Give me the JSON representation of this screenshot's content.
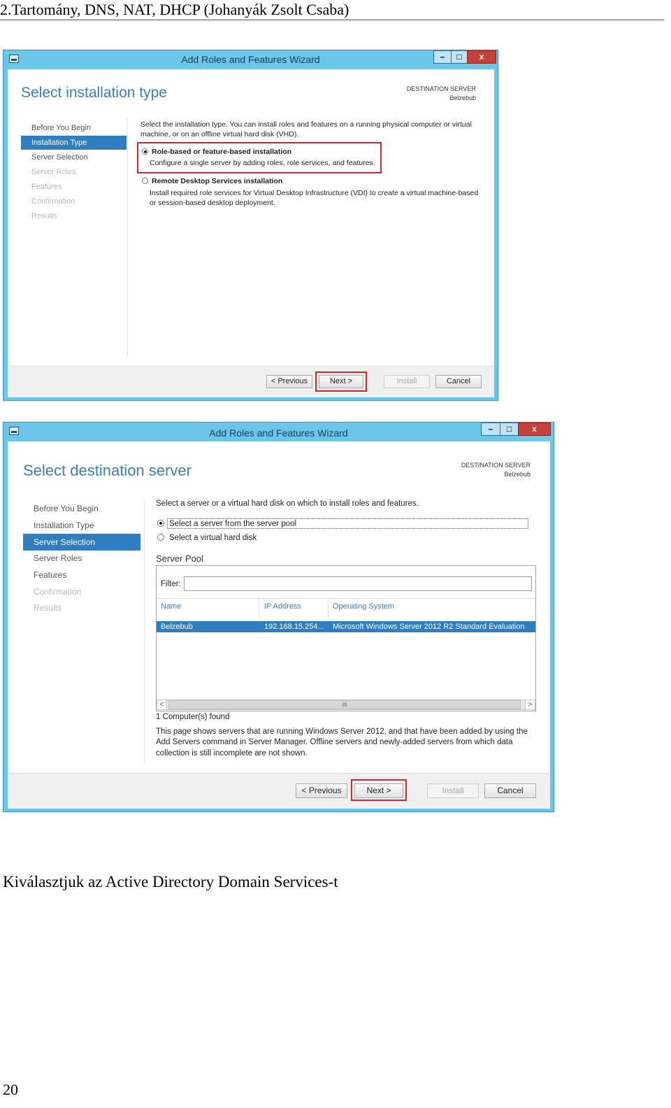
{
  "doc": {
    "header": "2.Tartomány, DNS, NAT, DHCP (Johanyák Zsolt Csaba)",
    "caption": "Kiválasztjuk az Active Directory Domain Services-t",
    "page_number": "20"
  },
  "colors": {
    "titlebar": "#6cc6ea",
    "accent": "#2f7ec1",
    "title_text": "#3b7fb6",
    "highlight": "#d8252d",
    "close": "#c7413a"
  },
  "window1": {
    "title": "Add Roles and Features Wizard",
    "page_title": "Select installation type",
    "dest_label": "DESTINATION SERVER",
    "dest_server": "Belzebub",
    "nav": [
      "Before You Begin",
      "Installation Type",
      "Server Selection",
      "Server Roles",
      "Features",
      "Confirmation",
      "Results"
    ],
    "intro_line1": "Select the installation type. You can install roles and features on a running physical computer or virtual",
    "intro_line2": "machine, or on an offline virtual hard disk (VHD).",
    "option1_title": "Role-based or feature-based installation",
    "option1_desc": "Configure a single server by adding roles, role services, and features.",
    "option2_title": "Remote Desktop Services installation",
    "option2_desc_line1": "Install required role services for Virtual Desktop Infrastructure (VDI) to create a virtual machine-based",
    "option2_desc_line2": "or session-based desktop deployment.",
    "buttons": {
      "previous": "< Previous",
      "next": "Next >",
      "install": "Install",
      "cancel": "Cancel"
    },
    "controls": {
      "minimize": "–",
      "maximize": "□",
      "close": "x"
    }
  },
  "window2": {
    "title": "Add Roles and Features Wizard",
    "page_title": "Select destination server",
    "dest_label": "DESTINATION SERVER",
    "dest_server": "Belzebub",
    "nav": [
      "Before You Begin",
      "Installation Type",
      "Server Selection",
      "Server Roles",
      "Features",
      "Confirmation",
      "Results"
    ],
    "intro": "Select a server or a virtual hard disk on which to install roles and features.",
    "option1": "Select a server from the server pool",
    "option2": "Select a virtual hard disk",
    "pool_title": "Server Pool",
    "filter_label": "Filter:",
    "filter_value": "",
    "columns": [
      "Name",
      "IP Address",
      "Operating System"
    ],
    "rows": [
      {
        "name": "Belzebub",
        "ip": "192.168.15.254...",
        "os": "Microsoft Windows Server 2012 R2 Standard Evaluation"
      }
    ],
    "scroll_left": "<",
    "scroll_right": ">",
    "scroll_grip": "III",
    "count": "1 Computer(s) found",
    "note_line1": "This page shows servers that are running Windows Server 2012, and that have been added by using the",
    "note_line2": "Add Servers command in Server Manager. Offline servers and newly-added servers from which data",
    "note_line3": "collection is still incomplete are not shown.",
    "buttons": {
      "previous": "< Previous",
      "next": "Next >",
      "install": "Install",
      "cancel": "Cancel"
    },
    "controls": {
      "minimize": "–",
      "maximize": "□",
      "close": "x"
    }
  }
}
